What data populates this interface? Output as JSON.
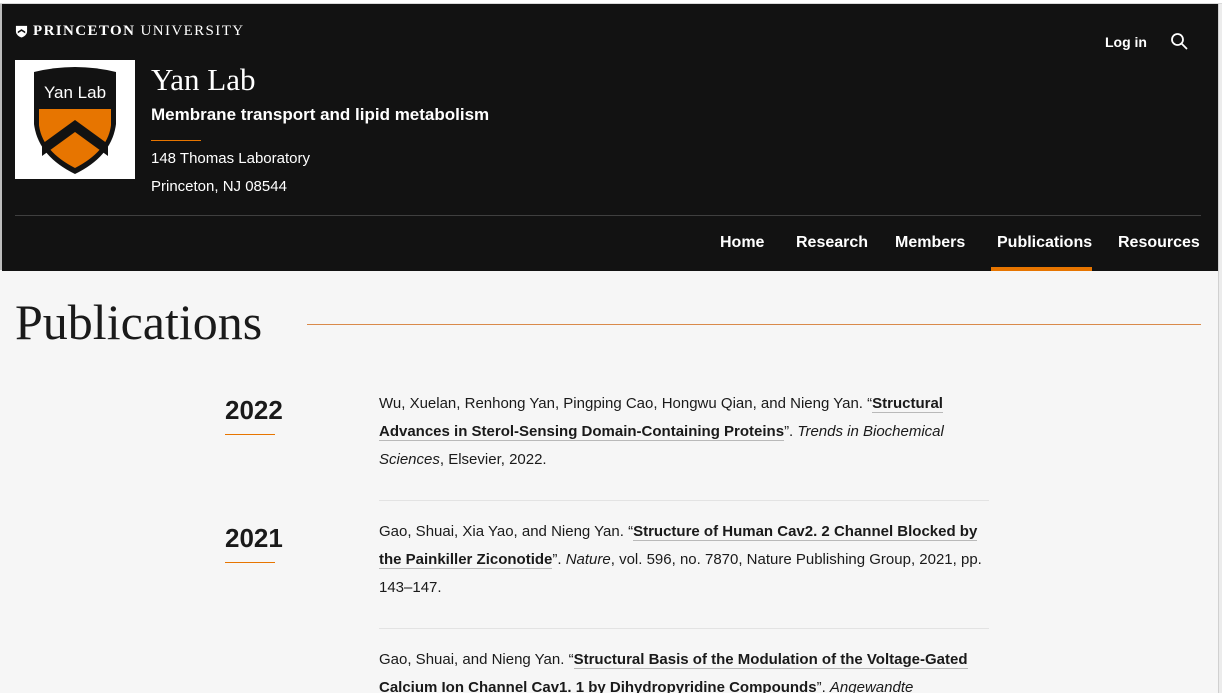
{
  "header": {
    "university": {
      "bold": "PRINCETON",
      "thin": "UNIVERSITY"
    },
    "login_label": "Log in",
    "logo_text": "Yan Lab",
    "lab_title": "Yan Lab",
    "lab_subtitle": "Membrane transport and lipid metabolism",
    "address_line1": "148 Thomas Laboratory",
    "address_line2": "Princeton, NJ 08544"
  },
  "nav": {
    "items": [
      {
        "label": "Home"
      },
      {
        "label": "Research"
      },
      {
        "label": "Members"
      },
      {
        "label": "Publications",
        "active": true
      },
      {
        "label": "Resources"
      }
    ]
  },
  "page": {
    "title": "Publications"
  },
  "publications": [
    {
      "year": "2022",
      "authors": "Wu, Xuelan, Renhong Yan, Pingping Cao, Hongwu Qian, and Nieng Yan. “",
      "title": "Structural Advances in Sterol-Sensing Domain-Containing Proteins",
      "after_title": "”. ",
      "journal": "Trends in Biochemical Sciences",
      "rest": ", Elsevier, 2022."
    },
    {
      "year": "2021",
      "authors": "Gao, Shuai, Xia Yao, and Nieng Yan. “",
      "title": "Structure of Human Cav2. 2 Channel Blocked by the Painkiller Ziconotide",
      "after_title": "”. ",
      "journal": "Nature",
      "rest": ", vol. 596, no. 7870, Nature Publishing Group, 2021, pp. 143–147."
    },
    {
      "year": "",
      "authors": "Gao, Shuai, and Nieng Yan. “",
      "title": "Structural Basis of the Modulation of the Voltage-Gated Calcium Ion Channel Cav1. 1 by Dihydropyridine Compounds",
      "after_title": "”. ",
      "journal": "Angewandte",
      "rest": ""
    }
  ],
  "colors": {
    "header_bg": "#121212",
    "accent_orange": "#e77500",
    "page_bg": "#f6f6f6"
  },
  "icons": [
    "princeton-shield-icon",
    "search-icon",
    "yan-lab-shield-logo"
  ]
}
